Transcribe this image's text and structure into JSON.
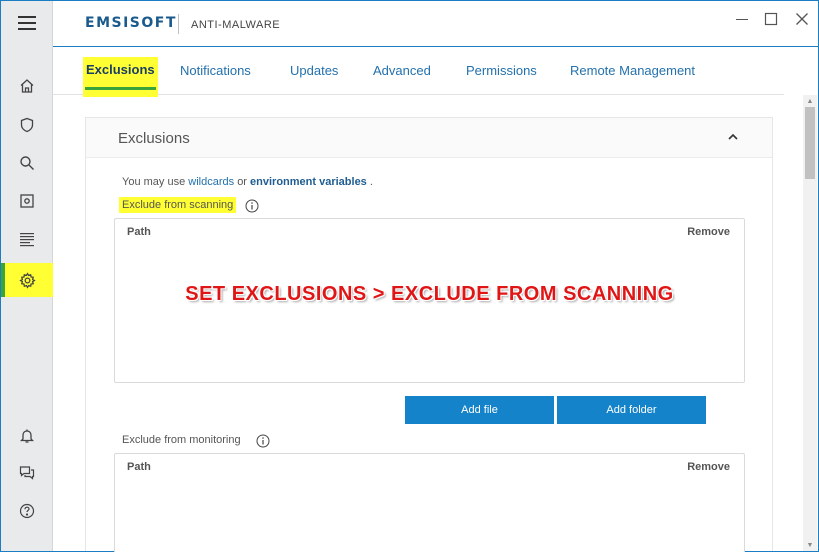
{
  "app": {
    "logo": "EMSISOFT",
    "product": "ANTI-MALWARE",
    "brand_color": "#1a5a8c",
    "accent_color": "#1483c9",
    "highlight_color": "#ffff33"
  },
  "window_controls": {
    "minimize": "minimize-icon",
    "maximize": "maximize-icon",
    "close": "close-icon"
  },
  "sidebar": {
    "menu_icon": "hamburger-icon",
    "items": [
      {
        "name": "home",
        "icon": "home-icon"
      },
      {
        "name": "protection",
        "icon": "shield-icon"
      },
      {
        "name": "scan",
        "icon": "search-icon"
      },
      {
        "name": "quarantine",
        "icon": "quarantine-icon"
      },
      {
        "name": "logs",
        "icon": "logs-icon"
      },
      {
        "name": "settings",
        "icon": "gear-icon",
        "active": true
      }
    ],
    "bottom_items": [
      {
        "name": "notifications",
        "icon": "bell-icon"
      },
      {
        "name": "feedback",
        "icon": "chat-icon"
      },
      {
        "name": "help",
        "icon": "help-icon"
      }
    ]
  },
  "tabs": [
    {
      "label": "Exclusions",
      "active": true
    },
    {
      "label": "Notifications"
    },
    {
      "label": "Updates"
    },
    {
      "label": "Advanced"
    },
    {
      "label": "Permissions"
    },
    {
      "label": "Remote Management"
    }
  ],
  "card": {
    "title": "Exclusions",
    "hint_prefix": "You may use",
    "hint_link1": "wildcards",
    "hint_mid": "or",
    "hint_link2": "environment variables",
    "hint_suffix": ".",
    "scan_section": {
      "label": "Exclude from scanning",
      "col_path": "Path",
      "col_remove": "Remove"
    },
    "add_file": "Add file",
    "add_folder": "Add folder",
    "monitor_section": {
      "label": "Exclude from monitoring",
      "col_path": "Path",
      "col_remove": "Remove"
    }
  },
  "annotation": "SET EXCLUSIONS > EXCLUDE FROM SCANNING"
}
